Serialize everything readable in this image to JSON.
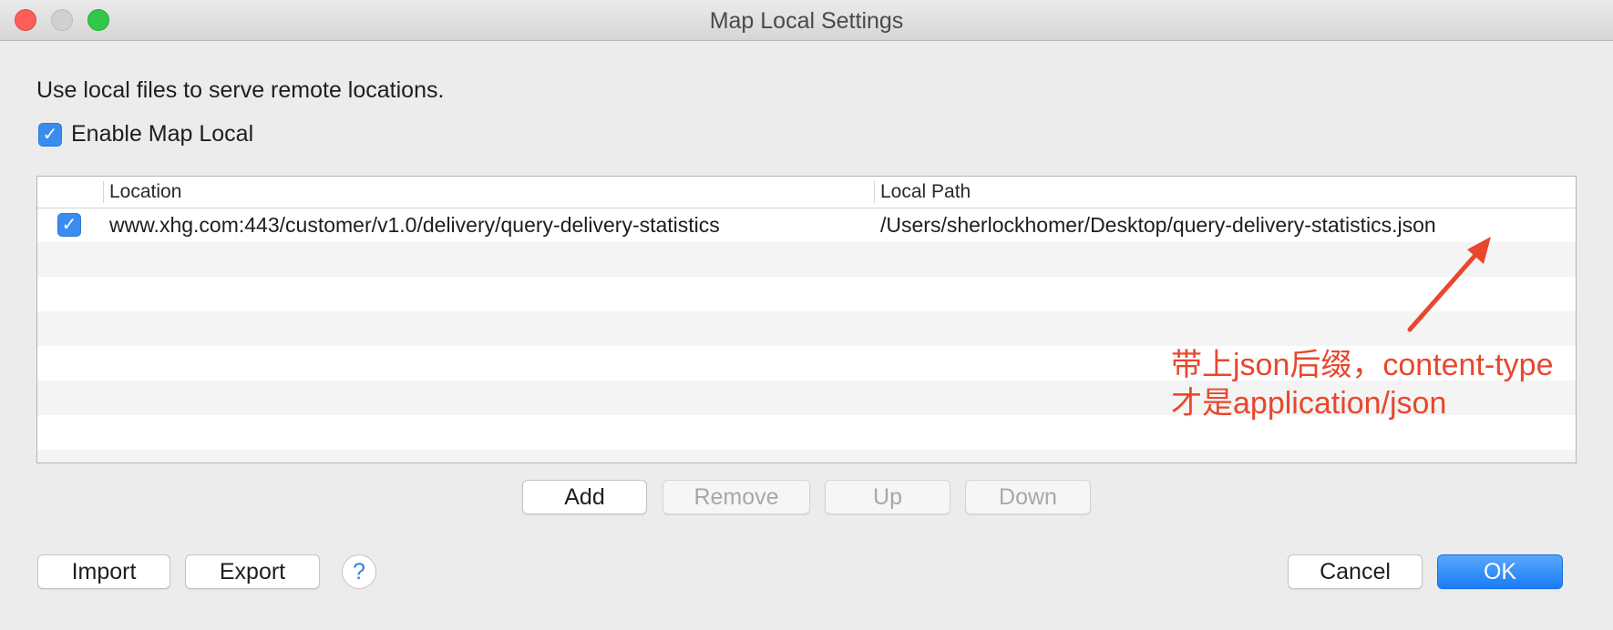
{
  "window": {
    "title": "Map Local Settings"
  },
  "description": "Use local files to serve remote locations.",
  "enable_checkbox": {
    "label": "Enable Map Local",
    "checked": true
  },
  "table": {
    "columns": [
      "Location",
      "Local Path"
    ],
    "rows": [
      {
        "enabled": true,
        "location": "www.xhg.com:443/customer/v1.0/delivery/query-delivery-statistics",
        "local_path": "/Users/sherlockhomer/Desktop/query-delivery-statistics.json"
      }
    ]
  },
  "row_buttons": {
    "add": "Add",
    "remove": "Remove",
    "up": "Up",
    "down": "Down"
  },
  "footer": {
    "import": "Import",
    "export": "Export",
    "help": "?",
    "cancel": "Cancel",
    "ok": "OK"
  },
  "annotation": {
    "line1": "带上json后缀，content-type",
    "line2": "才是application/json",
    "color": "#e8472d"
  },
  "colors": {
    "accent": "#1a7cf4",
    "close": "#fc5f57",
    "zoom": "#33c748"
  },
  "icons": {
    "check": "✓"
  }
}
